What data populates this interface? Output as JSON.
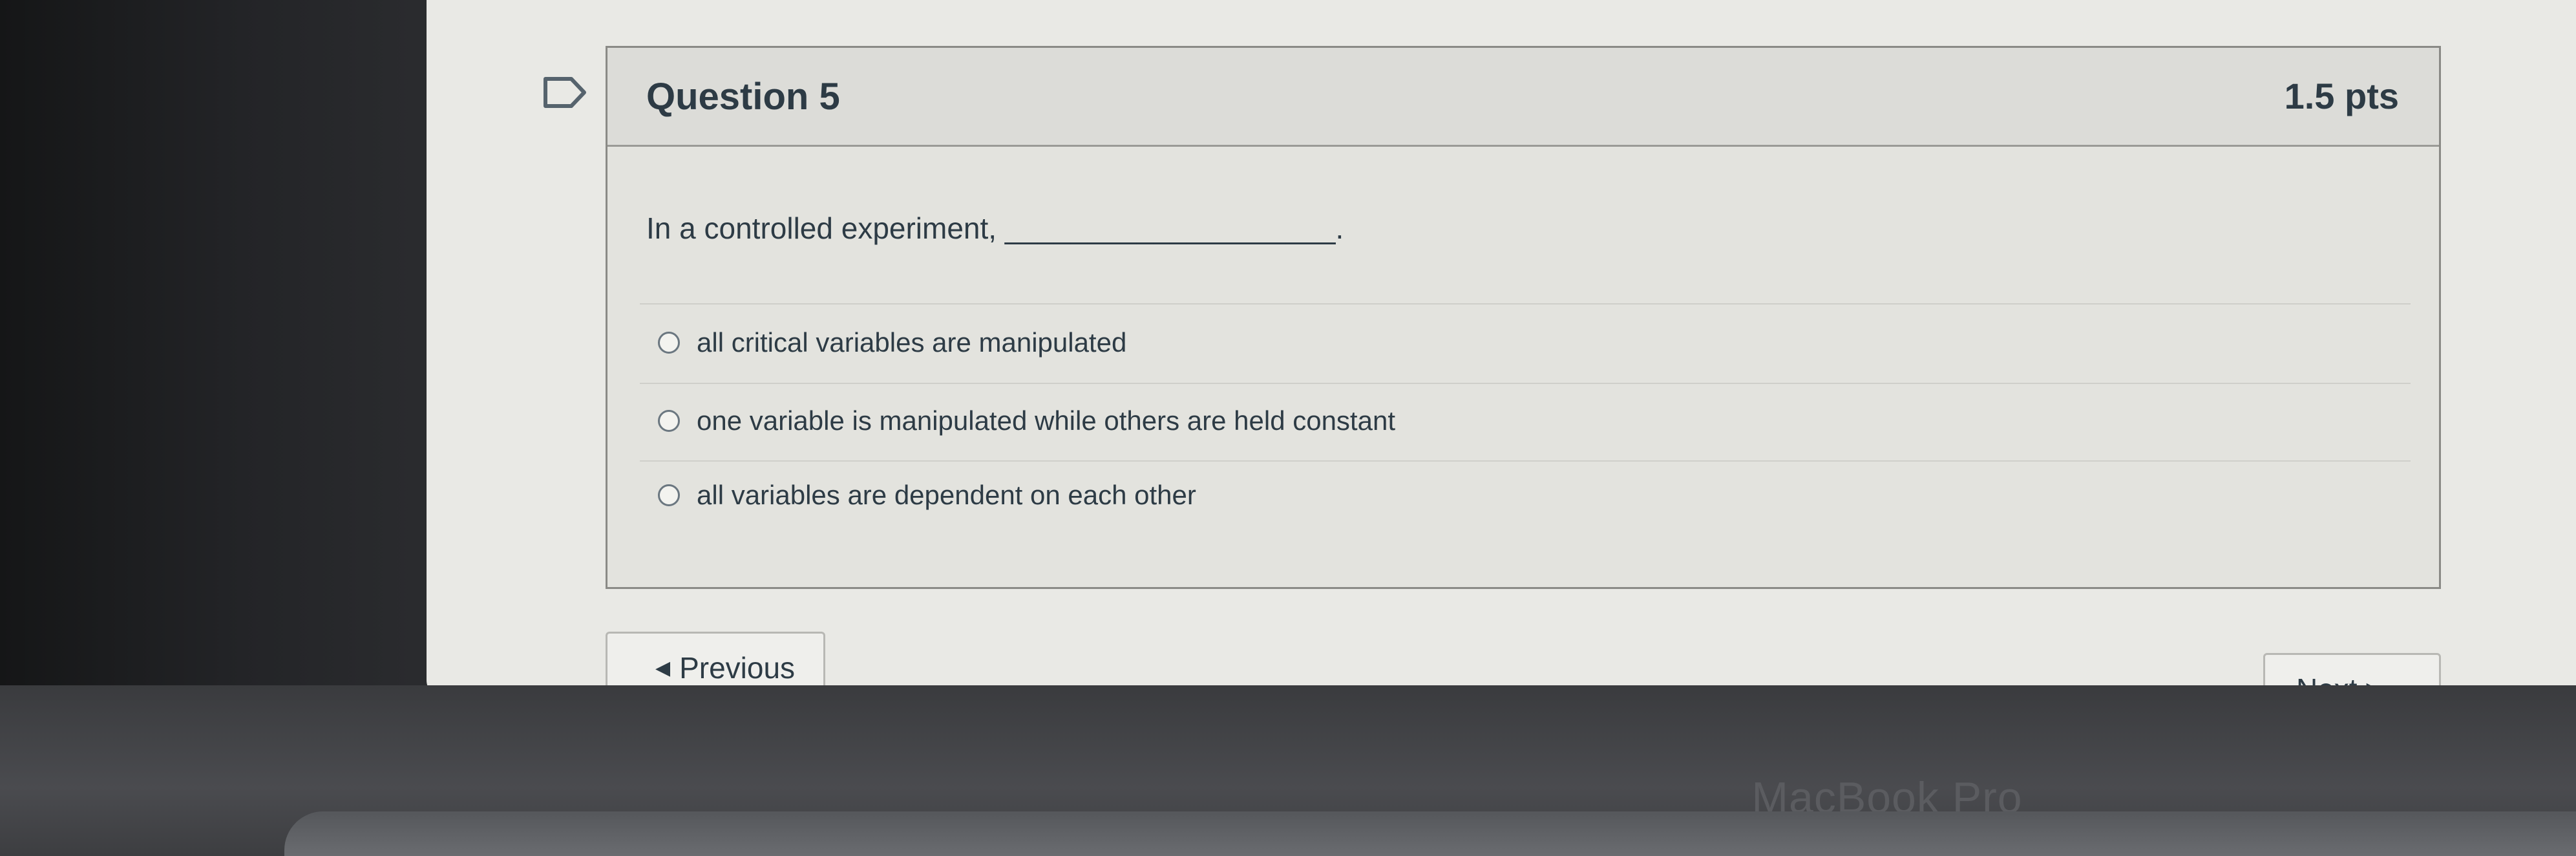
{
  "question": {
    "title": "Question 5",
    "points": "1.5 pts",
    "prompt": "In a controlled experiment, ____________________.",
    "answers": [
      {
        "label": "all critical variables are manipulated"
      },
      {
        "label": "one variable is manipulated while others are held constant"
      },
      {
        "label": "all variables are dependent on each other"
      }
    ]
  },
  "navigation": {
    "previous_label": "Previous",
    "next_label": "Next"
  },
  "device": {
    "brand": "MacBook Pro"
  },
  "icons": {
    "flag": "flag-icon",
    "prev_arrow": "arrow-left-icon",
    "next_arrow": "arrow-right-icon"
  }
}
